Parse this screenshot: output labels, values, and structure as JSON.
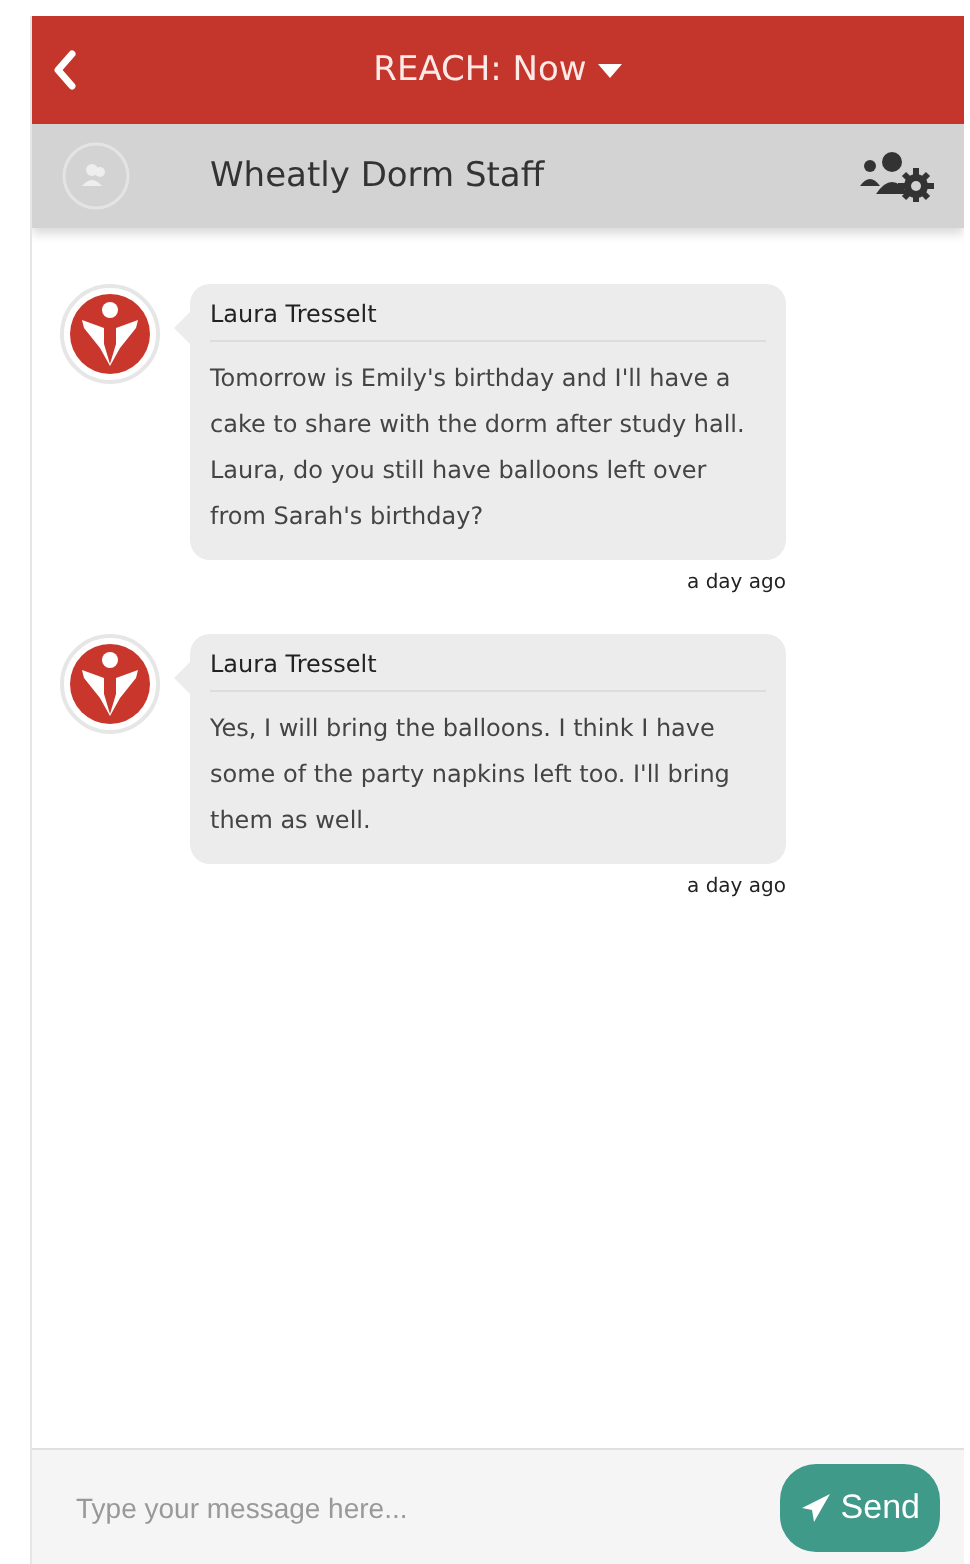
{
  "header": {
    "title": "REACH: Now"
  },
  "group": {
    "name": "Wheatly Dorm Staff"
  },
  "messages": [
    {
      "sender": "Laura Tresselt",
      "text": "Tomorrow is Emily's birthday and I'll have a cake to share with the dorm after study hall. Laura, do you still have balloons left over from Sarah's birthday?",
      "time": "a day ago"
    },
    {
      "sender": "Laura Tresselt",
      "text": "Yes, I will bring the balloons. I think I have some of the party napkins left too. I'll bring them as well.",
      "time": "a day ago"
    }
  ],
  "composer": {
    "placeholder": "Type your message here...",
    "send": "Send"
  }
}
